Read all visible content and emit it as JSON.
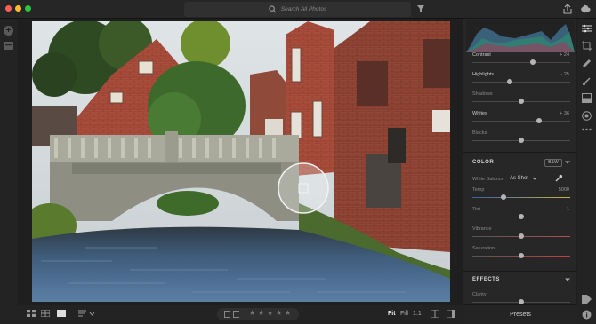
{
  "search": {
    "placeholder": "Search All Photos"
  },
  "icons": {
    "traffic_lights": [
      "#ff5f57",
      "#febc2e",
      "#28c840"
    ],
    "title_left": [
      "back-arrow-icon"
    ],
    "title_right": [
      "share-icon",
      "cloud-icon"
    ],
    "left_strip": [
      "add-photos-icon",
      "library-icon"
    ],
    "right_column": [
      "edit-sliders-icon",
      "crop-icon",
      "healing-brush-icon",
      "brush-icon",
      "linear-gradient-icon",
      "radial-gradient-icon",
      "more-icon",
      "tag-icon",
      "info-icon"
    ]
  },
  "edit": {
    "light_sliders": [
      {
        "label": "Contrast",
        "value": "+ 24",
        "level": 0.62,
        "highlight": true
      },
      {
        "label": "Highlights",
        "value": "- 25",
        "level": 0.38,
        "highlight": true
      },
      {
        "label": "Shadows",
        "value": "",
        "level": 0.5,
        "highlight": false
      },
      {
        "label": "Whites",
        "value": "+ 36",
        "level": 0.68,
        "highlight": true
      },
      {
        "label": "Blacks",
        "value": "",
        "level": 0.5,
        "highlight": false
      }
    ],
    "color": {
      "title": "COLOR",
      "bw_label": "B&W",
      "white_balance_label": "White Balance",
      "white_balance_value": "As Shot",
      "sliders": [
        {
          "label": "Temp",
          "value": "5000",
          "level": 0.32,
          "gradient": [
            "#3a5fb0",
            "#c9b341"
          ]
        },
        {
          "label": "Tint",
          "value": "- 1",
          "level": 0.5,
          "gradient": [
            "#3fa44a",
            "#b040a8"
          ]
        },
        {
          "label": "Vibrance",
          "value": "",
          "level": 0.5,
          "gradient": [
            "#555555",
            "#b05050"
          ]
        },
        {
          "label": "Saturation",
          "value": "",
          "level": 0.5,
          "gradient": [
            "#555555",
            "#c04040"
          ]
        }
      ]
    },
    "effects": {
      "title": "EFFECTS",
      "sliders": [
        {
          "label": "Clarity",
          "value": "",
          "level": 0.5
        }
      ]
    },
    "presets_label": "Presets"
  },
  "bottom": {
    "zoom": {
      "fit": "Fit",
      "fill": "Fill",
      "one_to_one": "1:1"
    },
    "stars": [
      "★",
      "★",
      "★",
      "★",
      "★"
    ]
  }
}
